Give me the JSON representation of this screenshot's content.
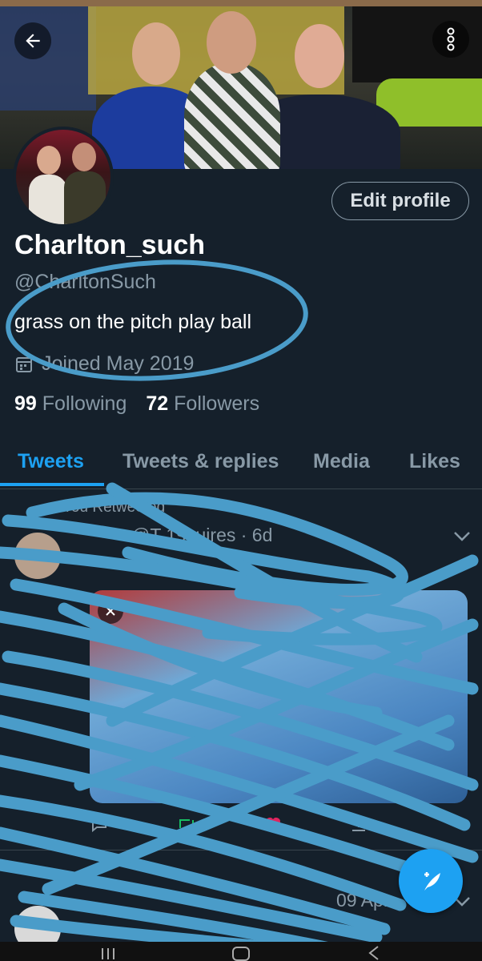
{
  "profile": {
    "display_name": "Charlton_such",
    "handle": "@CharltonSuch",
    "bio": "grass on the pitch play ball",
    "joined": "Joined May 2019",
    "following_count": "99",
    "following_label": "Following",
    "followers_count": "72",
    "followers_label": "Followers",
    "edit_label": "Edit profile"
  },
  "tabs": [
    {
      "label": "Tweets",
      "active": true
    },
    {
      "label": "Tweets & replies"
    },
    {
      "label": "Media"
    },
    {
      "label": "Likes"
    }
  ],
  "timeline": {
    "retweet_note": "You Retweeted",
    "tweet1_header": "· @T       1squires · 6d",
    "tweet2_date": "09 Apr"
  },
  "icons": {
    "back": "arrow-left-icon",
    "more": "more-vertical-icon",
    "calendar": "calendar-icon",
    "compose": "compose-feather-icon"
  },
  "colors": {
    "accent": "#1da1f2",
    "background": "#15202b",
    "muted": "#8899a6",
    "scribble": "#4a9cc9"
  }
}
